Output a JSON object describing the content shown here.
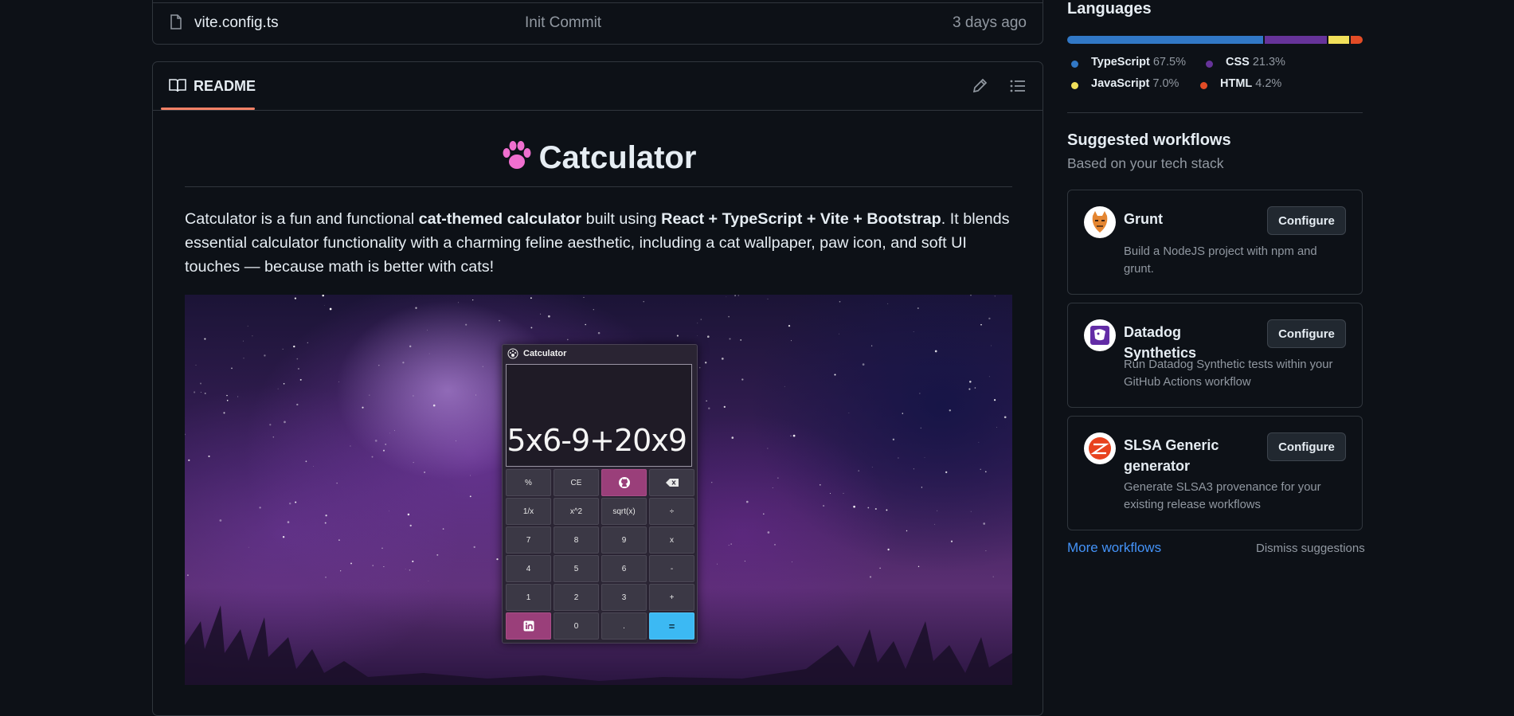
{
  "file_row": {
    "name": "vite.config.ts",
    "commit": "Init Commit",
    "time": "3 days ago"
  },
  "readme": {
    "tab_label": "README",
    "title": "Catculator",
    "paragraph": {
      "p1": "Catculator is a fun and functional ",
      "b1": "cat-themed calculator",
      "p2": " built using ",
      "b2": "React + TypeScript + Vite + Bootstrap",
      "p3": ". It blends essential calculator functionality with a charming feline aesthetic, including a cat wallpaper, paw icon, and soft UI touches — because math is better with cats!"
    },
    "calculator": {
      "title": "Catculator",
      "expression": "5x6-9+20x9",
      "keys": [
        "%",
        "CE",
        "",
        "",
        "1/x",
        "x^2",
        "sqrt(x)",
        "÷",
        "7",
        "8",
        "9",
        "x",
        "4",
        "5",
        "6",
        "-",
        "1",
        "2",
        "3",
        "+",
        "",
        "0",
        ".",
        "="
      ]
    }
  },
  "languages": {
    "title": "Languages",
    "items": [
      {
        "name": "TypeScript",
        "percent": "67.5%",
        "value": 67.5,
        "color": "#3178c6"
      },
      {
        "name": "CSS",
        "percent": "21.3%",
        "value": 21.3,
        "color": "#663399"
      },
      {
        "name": "JavaScript",
        "percent": "7.0%",
        "value": 7.0,
        "color": "#f1e05a"
      },
      {
        "name": "HTML",
        "percent": "4.2%",
        "value": 4.2,
        "color": "#e34c26"
      }
    ]
  },
  "workflows": {
    "title": "Suggested workflows",
    "subtitle": "Based on your tech stack",
    "button_label": "Configure",
    "items": [
      {
        "name": "Grunt",
        "desc": "Build a NodeJS project with npm and grunt.",
        "logo": "grunt-logo"
      },
      {
        "name": "Datadog Synthetics",
        "desc": "Run Datadog Synthetic tests within your GitHub Actions workflow",
        "logo": "datadog-logo"
      },
      {
        "name": "SLSA Generic generator",
        "desc": "Generate SLSA3 provenance for your existing release workflows",
        "logo": "slsa-logo"
      }
    ],
    "more_link": "More workflows",
    "dismiss": "Dismiss suggestions"
  }
}
